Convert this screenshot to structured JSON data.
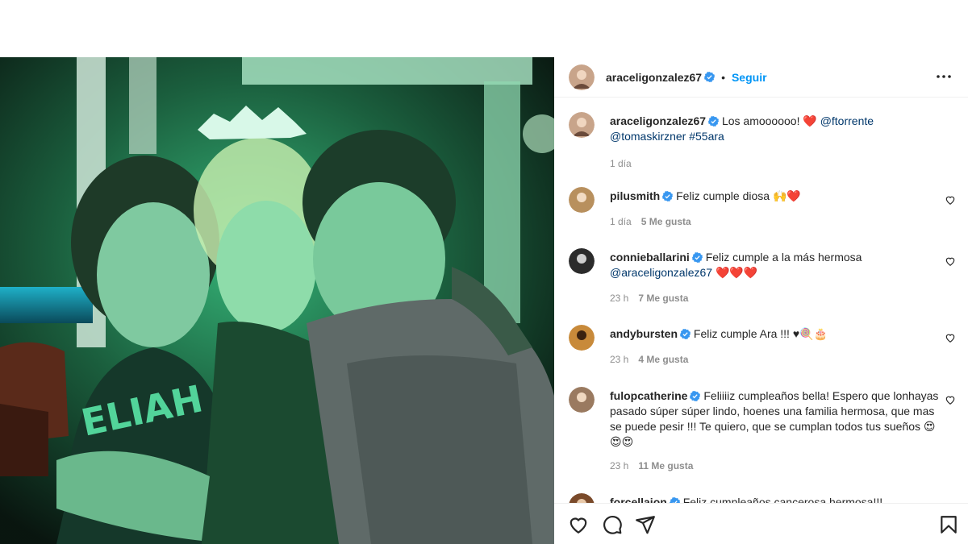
{
  "post": {
    "author": "araceligonzalez67",
    "follow_label": "Seguir",
    "dot": "•",
    "caption": {
      "username": "araceligonzalez67",
      "text": "Los amoooooo! ❤️",
      "tag1": "@ftorrente",
      "tag2": "@tomaskirzner",
      "hashtag": "#55ara",
      "time": "1 día"
    }
  },
  "comments": [
    {
      "username": "pilusmith",
      "text": "Feliz cumple diosa 🙌❤️",
      "time": "1 día",
      "likes": "5 Me gusta",
      "avatar_color": "#b8905e"
    },
    {
      "username": "connieballarini",
      "text": "Feliz cumple a la más hermosa",
      "mention": "@araceligonzalez67",
      "emojis": "❤️❤️❤️",
      "time": "23 h",
      "likes": "7 Me gusta",
      "avatar_color": "#2b2b2b"
    },
    {
      "username": "andybursten",
      "text": "Feliz cumple Ara !!! ♥🍭🎂",
      "time": "23 h",
      "likes": "4 Me gusta",
      "avatar_color": "#c88a3a"
    },
    {
      "username": "fulopcatherine",
      "text": "Feliiiiz cumpleaños bella! Espero que lonhayas pasado súper súper lindo, hoenes una familia hermosa, que mas se puede pesir !!! Te quiero, que se cumplan todos tus sueños 😍😍😍",
      "time": "23 h",
      "likes": "11 Me gusta",
      "avatar_color": "#9a7a60"
    },
    {
      "username": "forcellajon",
      "text": "Feliz cumpleaños cancerosa hermosa!!!",
      "avatar_color": "#7a4a2a"
    }
  ],
  "icons": {
    "more": "more-options-icon",
    "like": "heart-icon",
    "comment": "comment-icon",
    "share": "share-icon",
    "save": "bookmark-icon",
    "verified": "verified-badge-icon"
  },
  "colors": {
    "accent": "#0095f6",
    "verified": "#3897f0",
    "heart": "#ed4956"
  }
}
